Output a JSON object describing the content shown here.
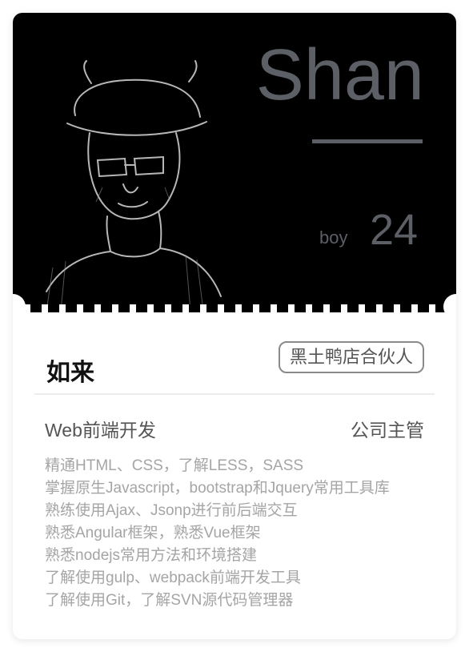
{
  "profile": {
    "name": "Shan",
    "gender": "boy",
    "age": "24",
    "nickname": "如来",
    "tag": "黑土鸭店合伙人",
    "role": "Web前端开发",
    "position": "公司主管"
  },
  "skills": [
    "精通HTML、CSS，了解LESS，SASS",
    "掌握原生Javascript，bootstrap和Jquery常用工具库",
    "熟练使用Ajax、Jsonp进行前后端交互",
    "熟悉Angular框架，熟悉Vue框架",
    "熟悉nodejs常用方法和环境搭建",
    "了解使用gulp、webpack前端开发工具",
    "了解使用Git，了解SVN源代码管理器"
  ],
  "colors": {
    "hero_bg": "#000000",
    "accent_gray": "#5c5f66",
    "body_text": "#555555",
    "muted_text": "#a5a5a5"
  },
  "icons": {
    "portrait": "portrait-sketch"
  }
}
